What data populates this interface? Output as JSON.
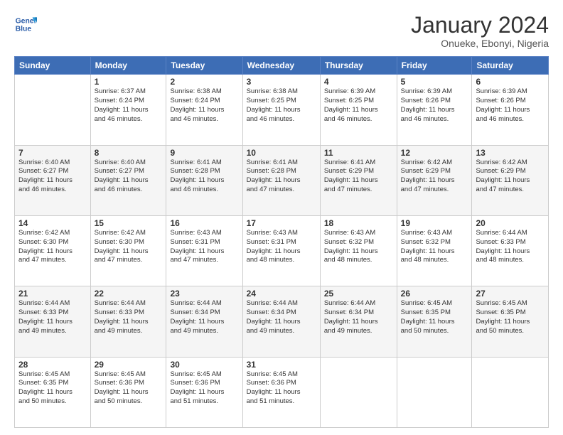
{
  "header": {
    "logo_line1": "General",
    "logo_line2": "Blue",
    "month": "January 2024",
    "location": "Onueke, Ebonyi, Nigeria"
  },
  "weekdays": [
    "Sunday",
    "Monday",
    "Tuesday",
    "Wednesday",
    "Thursday",
    "Friday",
    "Saturday"
  ],
  "weeks": [
    [
      {
        "day": "",
        "info": ""
      },
      {
        "day": "1",
        "info": "Sunrise: 6:37 AM\nSunset: 6:24 PM\nDaylight: 11 hours\nand 46 minutes."
      },
      {
        "day": "2",
        "info": "Sunrise: 6:38 AM\nSunset: 6:24 PM\nDaylight: 11 hours\nand 46 minutes."
      },
      {
        "day": "3",
        "info": "Sunrise: 6:38 AM\nSunset: 6:25 PM\nDaylight: 11 hours\nand 46 minutes."
      },
      {
        "day": "4",
        "info": "Sunrise: 6:39 AM\nSunset: 6:25 PM\nDaylight: 11 hours\nand 46 minutes."
      },
      {
        "day": "5",
        "info": "Sunrise: 6:39 AM\nSunset: 6:26 PM\nDaylight: 11 hours\nand 46 minutes."
      },
      {
        "day": "6",
        "info": "Sunrise: 6:39 AM\nSunset: 6:26 PM\nDaylight: 11 hours\nand 46 minutes."
      }
    ],
    [
      {
        "day": "7",
        "info": "Sunrise: 6:40 AM\nSunset: 6:27 PM\nDaylight: 11 hours\nand 46 minutes."
      },
      {
        "day": "8",
        "info": "Sunrise: 6:40 AM\nSunset: 6:27 PM\nDaylight: 11 hours\nand 46 minutes."
      },
      {
        "day": "9",
        "info": "Sunrise: 6:41 AM\nSunset: 6:28 PM\nDaylight: 11 hours\nand 46 minutes."
      },
      {
        "day": "10",
        "info": "Sunrise: 6:41 AM\nSunset: 6:28 PM\nDaylight: 11 hours\nand 47 minutes."
      },
      {
        "day": "11",
        "info": "Sunrise: 6:41 AM\nSunset: 6:29 PM\nDaylight: 11 hours\nand 47 minutes."
      },
      {
        "day": "12",
        "info": "Sunrise: 6:42 AM\nSunset: 6:29 PM\nDaylight: 11 hours\nand 47 minutes."
      },
      {
        "day": "13",
        "info": "Sunrise: 6:42 AM\nSunset: 6:29 PM\nDaylight: 11 hours\nand 47 minutes."
      }
    ],
    [
      {
        "day": "14",
        "info": "Sunrise: 6:42 AM\nSunset: 6:30 PM\nDaylight: 11 hours\nand 47 minutes."
      },
      {
        "day": "15",
        "info": "Sunrise: 6:42 AM\nSunset: 6:30 PM\nDaylight: 11 hours\nand 47 minutes."
      },
      {
        "day": "16",
        "info": "Sunrise: 6:43 AM\nSunset: 6:31 PM\nDaylight: 11 hours\nand 47 minutes."
      },
      {
        "day": "17",
        "info": "Sunrise: 6:43 AM\nSunset: 6:31 PM\nDaylight: 11 hours\nand 48 minutes."
      },
      {
        "day": "18",
        "info": "Sunrise: 6:43 AM\nSunset: 6:32 PM\nDaylight: 11 hours\nand 48 minutes."
      },
      {
        "day": "19",
        "info": "Sunrise: 6:43 AM\nSunset: 6:32 PM\nDaylight: 11 hours\nand 48 minutes."
      },
      {
        "day": "20",
        "info": "Sunrise: 6:44 AM\nSunset: 6:33 PM\nDaylight: 11 hours\nand 48 minutes."
      }
    ],
    [
      {
        "day": "21",
        "info": "Sunrise: 6:44 AM\nSunset: 6:33 PM\nDaylight: 11 hours\nand 49 minutes."
      },
      {
        "day": "22",
        "info": "Sunrise: 6:44 AM\nSunset: 6:33 PM\nDaylight: 11 hours\nand 49 minutes."
      },
      {
        "day": "23",
        "info": "Sunrise: 6:44 AM\nSunset: 6:34 PM\nDaylight: 11 hours\nand 49 minutes."
      },
      {
        "day": "24",
        "info": "Sunrise: 6:44 AM\nSunset: 6:34 PM\nDaylight: 11 hours\nand 49 minutes."
      },
      {
        "day": "25",
        "info": "Sunrise: 6:44 AM\nSunset: 6:34 PM\nDaylight: 11 hours\nand 49 minutes."
      },
      {
        "day": "26",
        "info": "Sunrise: 6:45 AM\nSunset: 6:35 PM\nDaylight: 11 hours\nand 50 minutes."
      },
      {
        "day": "27",
        "info": "Sunrise: 6:45 AM\nSunset: 6:35 PM\nDaylight: 11 hours\nand 50 minutes."
      }
    ],
    [
      {
        "day": "28",
        "info": "Sunrise: 6:45 AM\nSunset: 6:35 PM\nDaylight: 11 hours\nand 50 minutes."
      },
      {
        "day": "29",
        "info": "Sunrise: 6:45 AM\nSunset: 6:36 PM\nDaylight: 11 hours\nand 50 minutes."
      },
      {
        "day": "30",
        "info": "Sunrise: 6:45 AM\nSunset: 6:36 PM\nDaylight: 11 hours\nand 51 minutes."
      },
      {
        "day": "31",
        "info": "Sunrise: 6:45 AM\nSunset: 6:36 PM\nDaylight: 11 hours\nand 51 minutes."
      },
      {
        "day": "",
        "info": ""
      },
      {
        "day": "",
        "info": ""
      },
      {
        "day": "",
        "info": ""
      }
    ]
  ]
}
